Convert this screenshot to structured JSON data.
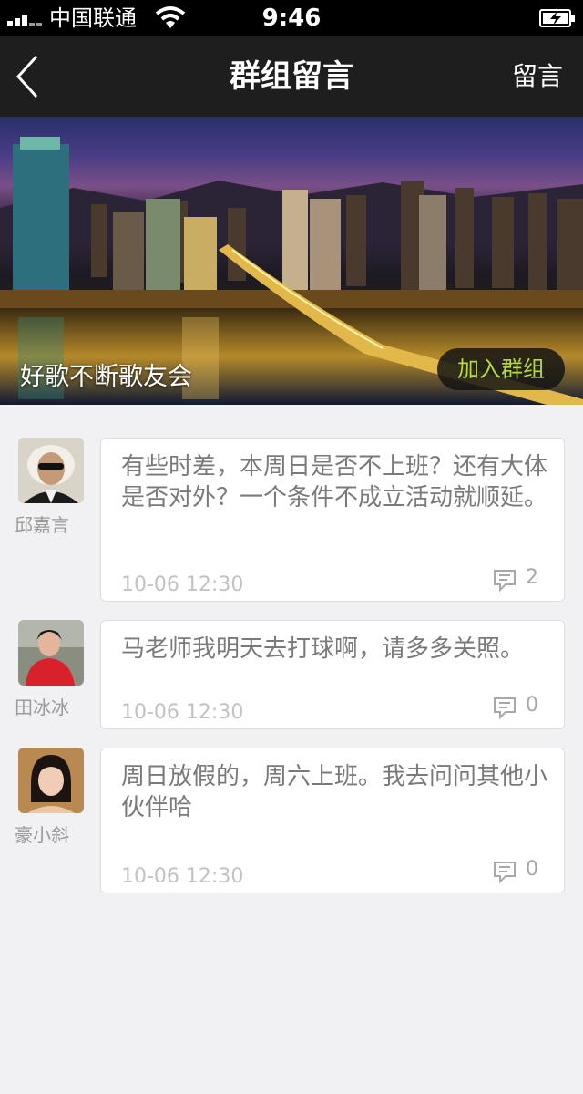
{
  "status_bar": {
    "carrier": "中国联通",
    "time": "9:46"
  },
  "nav": {
    "title": "群组留言",
    "action_label": "留言"
  },
  "group": {
    "name": "好歌不断歌友会",
    "join_label": "加入群组"
  },
  "messages": [
    {
      "author": "邱嘉言",
      "content": "有些时差，本周日是否不上班？还有大体是否对外？一个条件不成立活动就顺延。",
      "time": "10-06 12:30",
      "comment_count": "2"
    },
    {
      "author": "田冰冰",
      "content": "马老师我明天去打球啊，请多多关照。",
      "time": "10-06 12:30",
      "comment_count": "0"
    },
    {
      "author": "豪小斜",
      "content": "周日放假的，周六上班。我去问问其他小伙伴哈",
      "time": "10-06 12:30",
      "comment_count": "0"
    }
  ],
  "colors": {
    "background": "#f1f1f3",
    "nav_bar": "#1e1e1e",
    "join_text": "#b7dc3a"
  }
}
